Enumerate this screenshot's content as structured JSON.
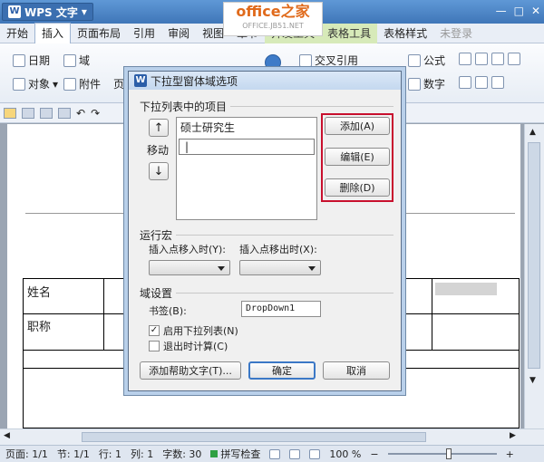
{
  "app": {
    "title": "WPS 文字",
    "logo_main": "office之家",
    "logo_sub": "OFFICE.JB51.NET"
  },
  "menu": [
    "开始",
    "插入",
    "页面布局",
    "引用",
    "审阅",
    "视图",
    "章节",
    "开发工具",
    "表格工具",
    "表格样式"
  ],
  "menu_right": {
    "login": "未登录"
  },
  "ribbon": {
    "date": "日期",
    "field": "域",
    "object": "对象",
    "attachment": "附件",
    "page_frag": "页",
    "crossref": "交叉引用",
    "formula": "公式",
    "number": "数字"
  },
  "document": {
    "name_label": "姓名",
    "title_label": "职称"
  },
  "status": {
    "page": "页面: 1/1",
    "section": "节: 1/1",
    "row": "行: 1",
    "col": "列: 1",
    "words": "字数: 30",
    "spell": "拼写检查",
    "zoom": "100 %"
  },
  "dialog": {
    "title": "下拉型窗体域选项",
    "list_group": "下拉列表中的项目",
    "move_label": "移动",
    "items": [
      "硕士研究生"
    ],
    "add": "添加(A)",
    "edit": "编辑(E)",
    "delete": "删除(D)",
    "macro_group": "运行宏",
    "macro_enter": "插入点移入时(Y):",
    "macro_exit": "插入点移出时(X):",
    "field_group": "域设置",
    "bookmark_label": "书签(B):",
    "bookmark_value": "DropDown1",
    "enable_dropdown": "启用下拉列表(N)",
    "calc_on_exit": "退出时计算(C)",
    "help_text": "添加帮助文字(T)...",
    "ok": "确定",
    "cancel": "取消"
  },
  "colors": {
    "highlight_border": "#c8102e",
    "title_blue": "#3f76b8"
  }
}
